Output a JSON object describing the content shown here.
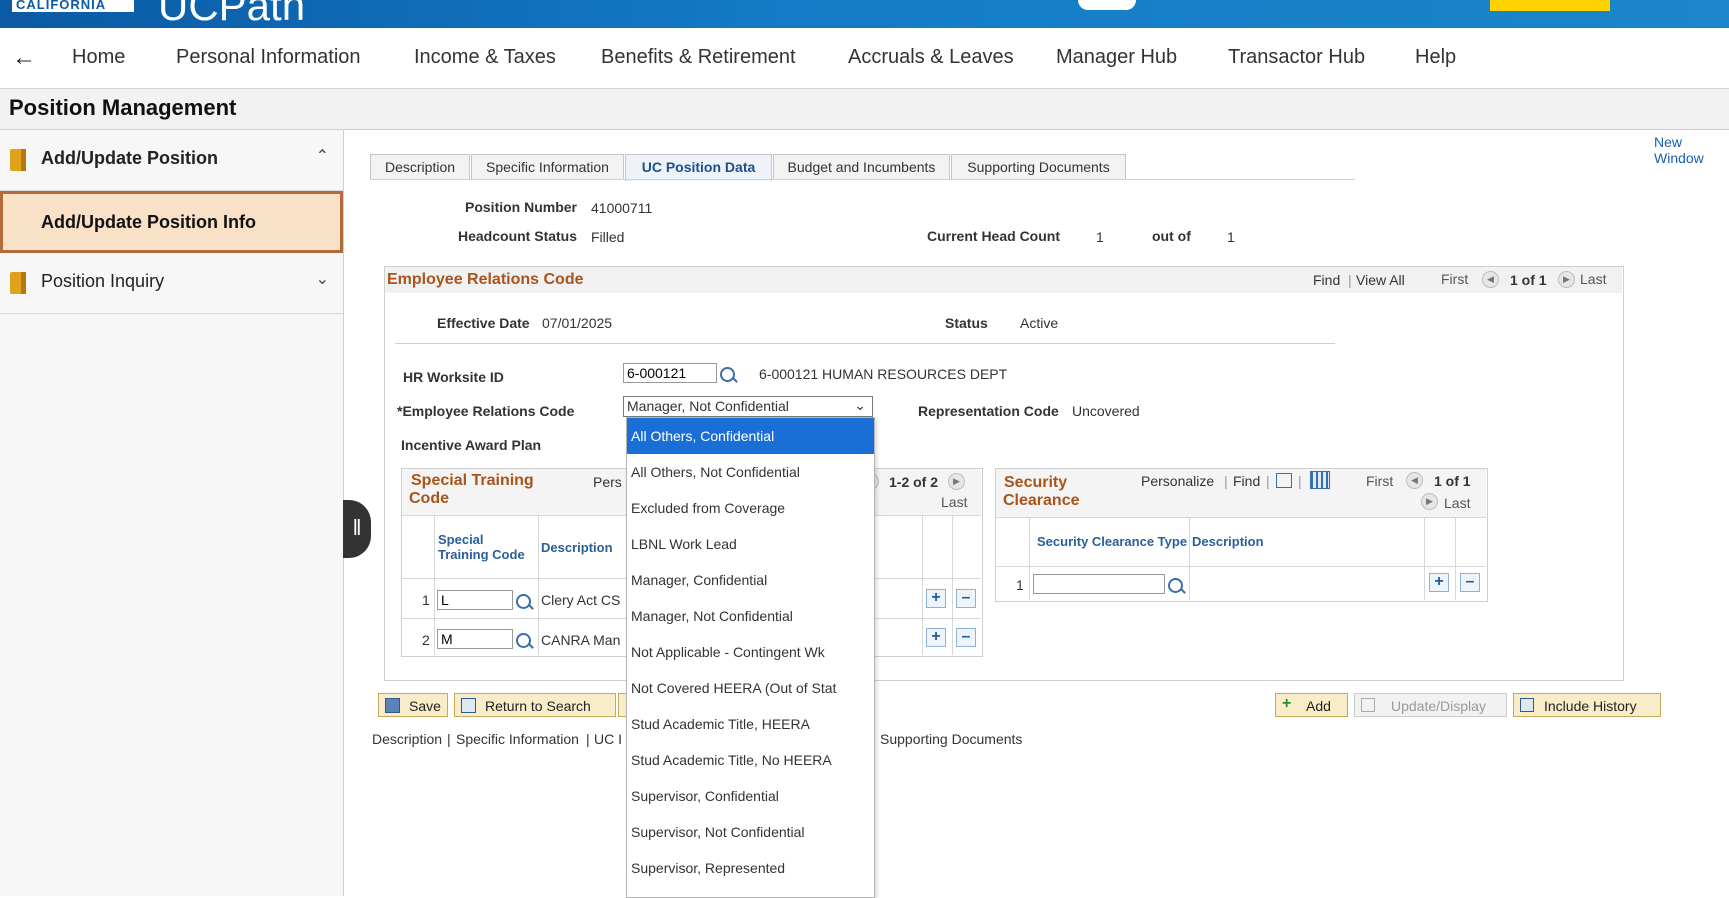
{
  "banner": {
    "logo_text": "CALIFORNIA",
    "brand": "UCPath"
  },
  "nav": {
    "back_icon": "left-arrow-icon",
    "items": [
      "Home",
      "Personal Information",
      "Income & Taxes",
      "Benefits & Retirement",
      "Accruals & Leaves",
      "Manager Hub",
      "Transactor Hub",
      "Help"
    ]
  },
  "page_title": "Position Management",
  "sidebar": {
    "group1": "Add/Update Position",
    "active_item": "Add/Update Position Info",
    "group2": "Position Inquiry"
  },
  "new_window": "New Window",
  "tabs": [
    "Description",
    "Specific Information",
    "UC Position Data",
    "Budget and Incumbents",
    "Supporting Documents"
  ],
  "position": {
    "number_label": "Position Number",
    "number": "41000711",
    "headcount_status_label": "Headcount Status",
    "headcount_status": "Filled",
    "current_head_count_label": "Current Head Count",
    "current_head_count": "1",
    "out_of_label": "out of",
    "out_of": "1"
  },
  "erc_section": {
    "title": "Employee Relations Code",
    "find": "Find",
    "view_all": "View All",
    "first": "First",
    "count": "1 of 1",
    "last": "Last",
    "effective_date_label": "Effective Date",
    "effective_date": "07/01/2025",
    "status_label": "Status",
    "status": "Active",
    "hr_worksite_label": "HR Worksite ID",
    "hr_worksite_value": "6-000121",
    "hr_worksite_desc": "6-000121 HUMAN RESOURCES DEPT",
    "erc_label": "*Employee Relations Code",
    "erc_selected": "Manager, Not Confidential",
    "rep_code_label": "Representation Code",
    "rep_code": "Uncovered",
    "incentive_label": "Incentive Award Plan"
  },
  "erc_options": [
    "All Others, Confidential",
    "All Others, Not Confidential",
    "Excluded from Coverage",
    "LBNL Work Lead",
    "Manager, Confidential",
    "Manager, Not Confidential",
    "Not Applicable - Contingent Wk",
    "Not Covered HEERA (Out of Stat",
    "Stud Academic Title, HEERA",
    "Stud Academic Title, No HEERA",
    "Supervisor, Confidential",
    "Supervisor, Not Confidential",
    "Supervisor, Represented"
  ],
  "special_training": {
    "title_line1": "Special Training",
    "title_line2": "Code",
    "personalize": "Pers",
    "count": "1-2 of 2",
    "last": "Last",
    "col_code_line1": "Special",
    "col_code_line2": "Training Code",
    "col_desc": "Description",
    "rows": [
      {
        "n": "1",
        "code": "L",
        "desc": "Clery Act CS"
      },
      {
        "n": "2",
        "code": "M",
        "desc": "CANRA Man"
      }
    ]
  },
  "security": {
    "title_line1": "Security",
    "title_line2": "Clearance",
    "personalize": "Personalize",
    "find": "Find",
    "first": "First",
    "count": "1 of 1",
    "last": "Last",
    "col_type": "Security Clearance Type",
    "col_desc": "Description",
    "row_n": "1"
  },
  "buttons": {
    "save": "Save",
    "return_to_search": "Return to Search",
    "add": "Add",
    "update_display": "Update/Display",
    "include_history": "Include History"
  },
  "footer_links": [
    "Description",
    "Specific Information",
    "UC I",
    "Supporting Documents"
  ],
  "colors": {
    "banner": "#137bc7",
    "accent_orange": "#a8541b",
    "link": "#1a5fa8",
    "selected_option": "#1a6fd6"
  }
}
